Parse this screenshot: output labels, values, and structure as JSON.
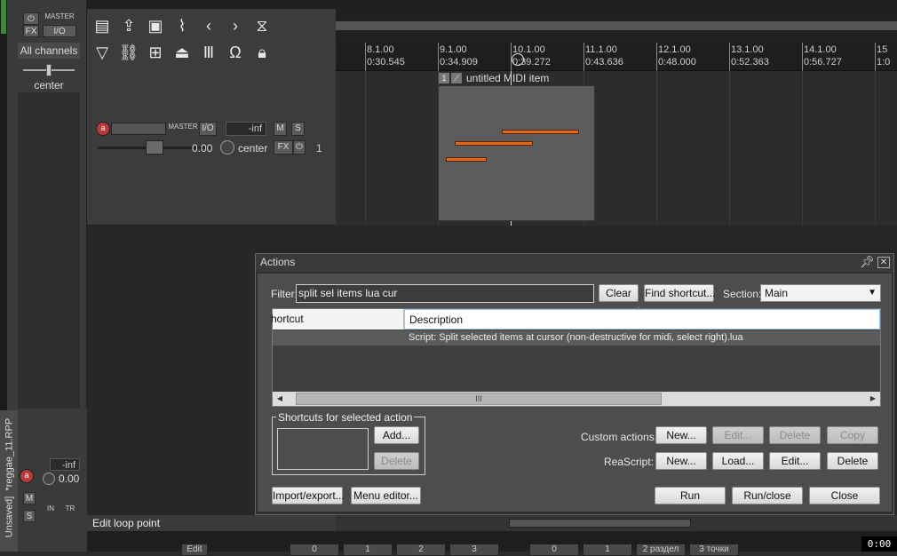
{
  "master": {
    "fx_label": "FX",
    "master_label": "MASTER",
    "io_label": "I/O",
    "channels_label": "All channels",
    "pan_label": "center"
  },
  "track": {
    "rec_label": "a",
    "master_send": "MASTER",
    "io_label": "I/O",
    "volume_readout": "-inf",
    "mute_label": "M",
    "solo_label": "S",
    "fader_value": "0.00",
    "pan_label": "center",
    "fx_label": "FX",
    "track_number": "1"
  },
  "ruler": {
    "marks": [
      {
        "bar": "8.1.00",
        "time": "0:30.545"
      },
      {
        "bar": "9.1.00",
        "time": "0:34.909"
      },
      {
        "bar": "10.1.00",
        "time": "0:39.272"
      },
      {
        "bar": "11.1.00",
        "time": "0:43.636"
      },
      {
        "bar": "12.1.00",
        "time": "0:48.000"
      },
      {
        "bar": "13.1.00",
        "time": "0:52.363"
      },
      {
        "bar": "14.1.00",
        "time": "0:56.727"
      },
      {
        "bar": "15",
        "time": "1:0"
      }
    ]
  },
  "midi_item": {
    "name": "untitled MIDI item"
  },
  "status": {
    "text": "Edit loop point",
    "time": "0:00"
  },
  "mini_track": {
    "project_tab": "*reggae_11.RPP",
    "unsaved_tab": "Unsaved]",
    "volume": "-inf",
    "fader_value": "0.00",
    "mute": "M",
    "solo": "S",
    "in": "IN",
    "tr": "TR"
  },
  "bottom_tabs": [
    "Edit",
    "0",
    "1",
    "2",
    "3",
    "0",
    "1",
    "2 раздел",
    "3 точки"
  ],
  "dialog": {
    "title": "Actions",
    "filter_label": "Filter:",
    "filter_value": "split sel items lua cur",
    "clear_button": "Clear",
    "find_shortcut_button": "Find shortcut...",
    "section_label": "Section:",
    "section_value": "Main",
    "columns": {
      "shortcut": "hortcut",
      "description": "Description"
    },
    "rows": [
      {
        "shortcut": "",
        "description": "Script: Split selected items at cursor (non-destructive for midi, select right).lua"
      }
    ],
    "scroll_thumb": "III",
    "shortcuts_group_label": "Shortcuts for selected action",
    "add_button": "Add...",
    "delete_shortcut_button": "Delete",
    "custom_actions_label": "Custom actions:",
    "custom_new": "New...",
    "custom_edit": "Edit...",
    "custom_delete": "Delete",
    "custom_copy": "Copy",
    "reascript_label": "ReaScript:",
    "script_new": "New...",
    "script_load": "Load...",
    "script_edit": "Edit...",
    "script_delete": "Delete",
    "import_export_button": "Import/export...",
    "menu_editor_button": "Menu editor...",
    "run_button": "Run",
    "run_close_button": "Run/close",
    "close_button": "Close"
  }
}
